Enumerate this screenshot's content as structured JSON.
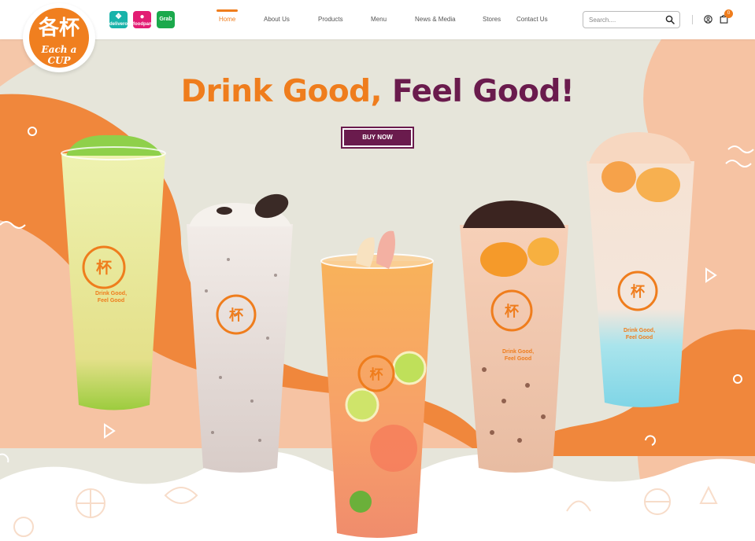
{
  "brand": {
    "logo_glyph": "各杯",
    "logo_text": "Each a CUP"
  },
  "delivery_partners": [
    {
      "name": "deliveroo",
      "icon": "deliveroo-kangaroo-icon",
      "label": "deliveroo"
    },
    {
      "name": "foodpanda",
      "icon": "foodpanda-panda-icon",
      "label": "foodpanda"
    },
    {
      "name": "grab",
      "icon": "grab-icon",
      "label": "Grab"
    }
  ],
  "nav": {
    "items": [
      {
        "label": "Home",
        "active": true
      },
      {
        "label": "About Us",
        "active": false
      },
      {
        "label": "Products",
        "active": false
      },
      {
        "label": "Menu",
        "active": false
      },
      {
        "label": "News & Media",
        "active": false
      },
      {
        "label": "Stores",
        "active": false
      },
      {
        "label": "Contact Us",
        "active": false
      }
    ]
  },
  "search": {
    "placeholder": "Search....",
    "value": "",
    "icon": "search-icon"
  },
  "user": {
    "icon": "account-icon"
  },
  "cart": {
    "icon": "shopping-bag-icon",
    "count": "0"
  },
  "hero": {
    "headline_part1": "Drink Good,",
    "headline_part2": "Feel Good!",
    "cta_label": "BUY NOW",
    "cup_slogan_line1": "Drink Good,",
    "cup_slogan_line2": "Feel Good"
  },
  "colors": {
    "brand_orange": "#ef7d1d",
    "brand_purple": "#6a1b4d",
    "peach": "#f6c3a3"
  }
}
